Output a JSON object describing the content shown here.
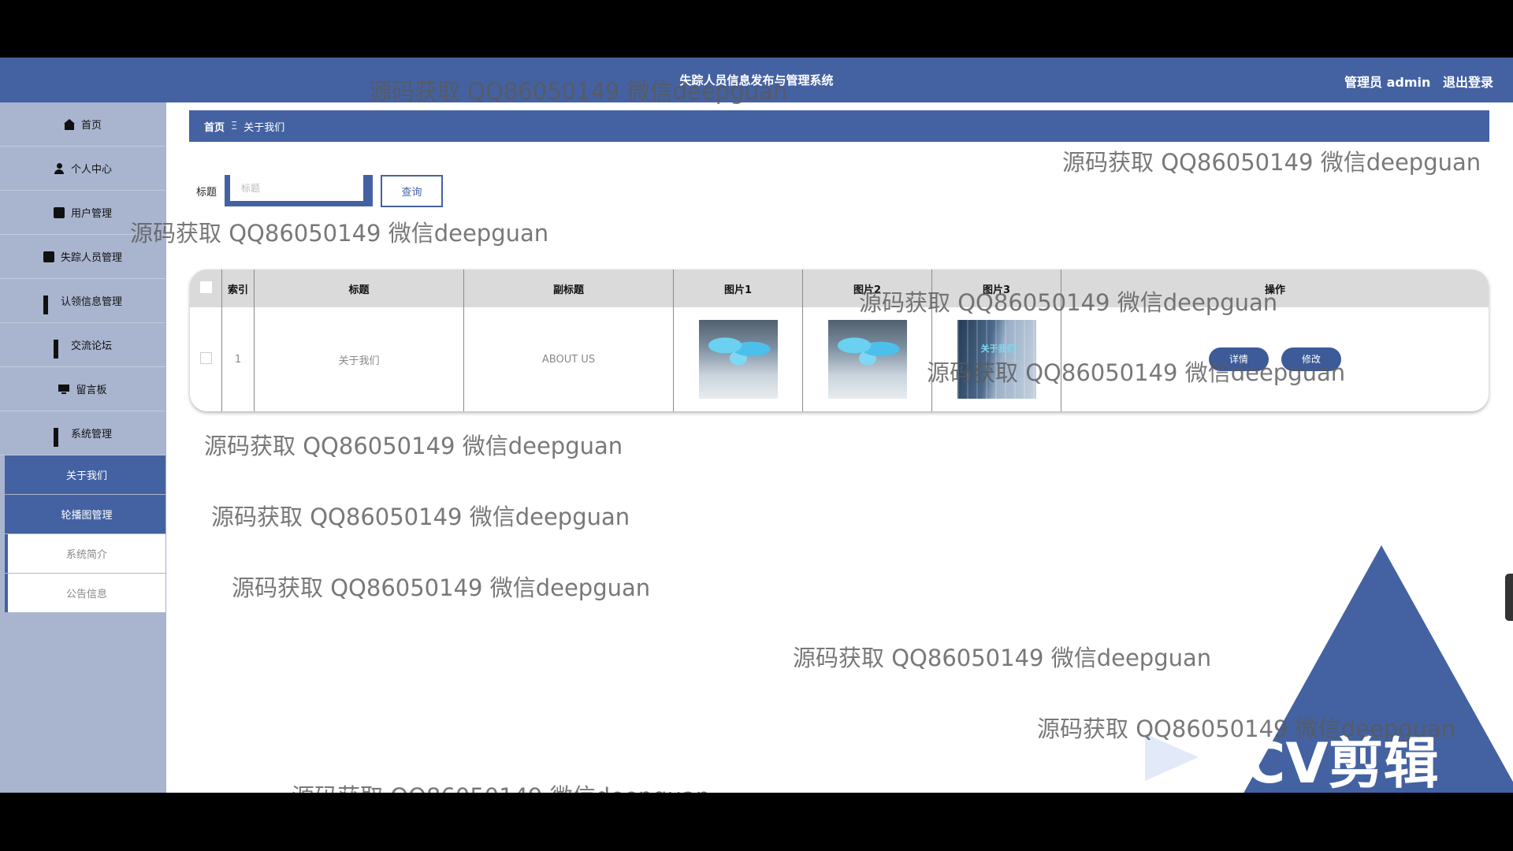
{
  "header": {
    "title": "失踪人员信息发布与管理系统",
    "user_label": "管理员 admin",
    "logout_label": "退出登录"
  },
  "sidebar": {
    "items": [
      {
        "label": "首页",
        "icon": "home-icon"
      },
      {
        "label": "个人中心",
        "icon": "user-icon"
      },
      {
        "label": "用户管理",
        "icon": "clipboard-icon"
      },
      {
        "label": "失踪人员管理",
        "icon": "chat-icon"
      },
      {
        "label": "认领信息管理",
        "icon": "grid-icon"
      },
      {
        "label": "交流论坛",
        "icon": "grid-icon"
      },
      {
        "label": "留言板",
        "icon": "monitor-icon"
      },
      {
        "label": "系统管理",
        "icon": "grid-icon"
      }
    ],
    "sub_items": [
      {
        "label": "关于我们",
        "active": true
      },
      {
        "label": "轮播图管理",
        "active": true
      },
      {
        "label": "系统简介",
        "active": false
      },
      {
        "label": "公告信息",
        "active": false
      }
    ]
  },
  "breadcrumb": {
    "home": "首页",
    "separator": "Ξ",
    "current": "关于我们"
  },
  "search": {
    "label": "标题",
    "placeholder": "标题",
    "button": "查询"
  },
  "table": {
    "columns": [
      "",
      "索引",
      "标题",
      "副标题",
      "图片1",
      "图片2",
      "图片3",
      "操作"
    ],
    "rows": [
      {
        "index": "1",
        "title": "关于我们",
        "subtitle": "ABOUT US",
        "img3_text": "关于我们",
        "actions": [
          "详情",
          "修改"
        ]
      }
    ]
  },
  "watermark": "源码获取 QQ86050149 微信deepguan",
  "logo_text": "CV剪辑",
  "colors": {
    "primary": "#4462a2",
    "sidebar": "#a9b5cf",
    "header_row": "#dadada"
  }
}
